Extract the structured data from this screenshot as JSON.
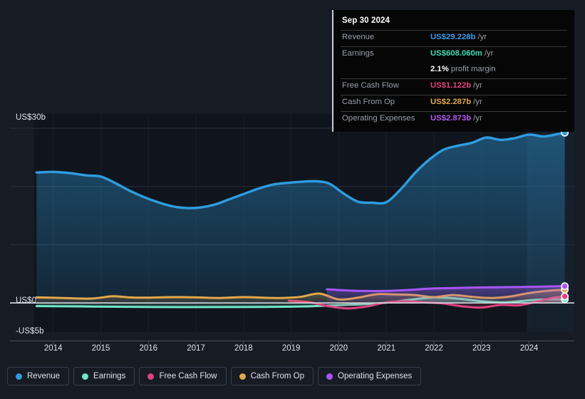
{
  "chart_data": {
    "type": "area",
    "title": "",
    "xlabel": "",
    "ylabel": "",
    "ylim": [
      -5,
      30
    ],
    "xlim": [
      2013.6,
      2024.95
    ],
    "grid": true,
    "legend_position": "bottom",
    "y_ticks": [
      {
        "value": 30,
        "label": "US$30b"
      },
      {
        "value": 0,
        "label": "US$0"
      },
      {
        "value": -5,
        "label": "-US$5b"
      }
    ],
    "x_ticks": [
      "2014",
      "2015",
      "2016",
      "2017",
      "2018",
      "2019",
      "2020",
      "2021",
      "2022",
      "2023",
      "2024"
    ],
    "series": [
      {
        "name": "Revenue",
        "color": "#2e9de0",
        "x": [
          2013.65,
          2014.0,
          2014.35,
          2014.7,
          2015.0,
          2015.3,
          2015.6,
          2015.9,
          2016.2,
          2016.5,
          2016.8,
          2017.1,
          2017.4,
          2017.7,
          2018.0,
          2018.3,
          2018.6,
          2018.9,
          2019.2,
          2019.5,
          2019.8,
          2020.1,
          2020.4,
          2020.7,
          2021.0,
          2021.3,
          2021.6,
          2021.9,
          2022.2,
          2022.5,
          2022.8,
          2023.1,
          2023.4,
          2023.7,
          2024.0,
          2024.3,
          2024.6,
          2024.75
        ],
        "values": [
          22.4,
          22.5,
          22.3,
          21.9,
          21.7,
          20.6,
          19.3,
          18.2,
          17.3,
          16.6,
          16.3,
          16.4,
          16.9,
          17.8,
          18.7,
          19.6,
          20.3,
          20.6,
          20.8,
          20.9,
          20.5,
          18.8,
          17.4,
          17.2,
          17.3,
          19.5,
          22.3,
          24.6,
          26.3,
          27.0,
          27.5,
          28.4,
          28.0,
          28.3,
          28.9,
          28.6,
          29.0,
          29.228
        ]
      },
      {
        "name": "Earnings",
        "color": "#6fe7c8",
        "x": [
          2013.65,
          2014.5,
          2015.3,
          2016.1,
          2016.9,
          2017.7,
          2018.5,
          2019.3,
          2020.1,
          2020.6,
          2021.0,
          2021.5,
          2022.0,
          2022.5,
          2023.0,
          2023.5,
          2024.0,
          2024.4,
          2024.75
        ],
        "values": [
          -0.55,
          -0.6,
          -0.65,
          -0.7,
          -0.72,
          -0.7,
          -0.68,
          -0.6,
          -0.35,
          -0.2,
          0.05,
          0.55,
          0.95,
          0.75,
          0.3,
          0.1,
          0.45,
          0.62,
          0.608
        ]
      },
      {
        "name": "Free Cash Flow",
        "color": "#e0437f",
        "x": [
          2018.95,
          2019.4,
          2019.8,
          2020.2,
          2020.6,
          2021.0,
          2021.4,
          2021.8,
          2022.2,
          2022.6,
          2023.0,
          2023.4,
          2023.8,
          2024.2,
          2024.5,
          2024.75
        ],
        "values": [
          0.4,
          0.1,
          -0.6,
          -0.95,
          -0.6,
          0.1,
          0.3,
          0.1,
          -0.1,
          -0.6,
          -0.8,
          -0.35,
          -0.4,
          0.3,
          0.9,
          1.122
        ]
      },
      {
        "name": "Cash From Op",
        "color": "#e3a84a",
        "x": [
          2013.65,
          2014.2,
          2014.8,
          2015.25,
          2015.6,
          2016.0,
          2016.5,
          2017.0,
          2017.5,
          2018.0,
          2018.4,
          2018.8,
          2019.2,
          2019.6,
          2020.0,
          2020.4,
          2020.8,
          2021.2,
          2021.6,
          2022.0,
          2022.4,
          2022.8,
          2023.2,
          2023.6,
          2024.0,
          2024.4,
          2024.75
        ],
        "values": [
          0.95,
          0.85,
          0.75,
          1.15,
          0.95,
          0.9,
          1.0,
          0.95,
          0.85,
          1.0,
          0.9,
          0.85,
          1.05,
          1.6,
          0.6,
          0.9,
          1.5,
          1.45,
          1.35,
          1.0,
          1.35,
          1.05,
          0.85,
          1.1,
          1.7,
          2.1,
          2.287
        ]
      },
      {
        "name": "Operating Expenses",
        "color": "#a855f7",
        "x": [
          2019.75,
          2020.3,
          2020.9,
          2021.4,
          2021.9,
          2022.4,
          2022.9,
          2023.4,
          2023.9,
          2024.4,
          2024.75
        ],
        "values": [
          2.35,
          2.1,
          2.05,
          2.2,
          2.45,
          2.55,
          2.65,
          2.7,
          2.75,
          2.82,
          2.873
        ]
      }
    ]
  },
  "tooltip": {
    "date": "Sep 30 2024",
    "rows": [
      {
        "key": "Revenue",
        "value": "US$29.228b",
        "suffix": "/yr",
        "color": "#3d9ae8",
        "rule": true
      },
      {
        "key": "Earnings",
        "value": "US$608.060m",
        "suffix": "/yr",
        "color": "#3ddcb0",
        "rule": true
      },
      {
        "key": "",
        "value": "2.1%",
        "suffix": "profit margin",
        "color": "#ffffff",
        "rule": false
      },
      {
        "key": "Free Cash Flow",
        "value": "US$1.122b",
        "suffix": "/yr",
        "color": "#e0437f",
        "rule": true
      },
      {
        "key": "Cash From Op",
        "value": "US$2.287b",
        "suffix": "/yr",
        "color": "#e3a84a",
        "rule": true
      },
      {
        "key": "Operating Expenses",
        "value": "US$2.873b",
        "suffix": "/yr",
        "color": "#b35cf5",
        "rule": true
      }
    ]
  },
  "legend": {
    "items": [
      {
        "label": "Revenue",
        "color": "#2e9de0"
      },
      {
        "label": "Earnings",
        "color": "#6fe7c8"
      },
      {
        "label": "Free Cash Flow",
        "color": "#e0437f"
      },
      {
        "label": "Cash From Op",
        "color": "#e3a84a"
      },
      {
        "label": "Operating Expenses",
        "color": "#a855f7"
      }
    ]
  },
  "colors": {
    "background": "#161b24",
    "plot_background": "#10151d",
    "gridline": "#2b313c",
    "zero_line": "#d6dae0",
    "axis_text": "#dfe3ea",
    "tooltip_background": "#060606",
    "tooltip_border": "#c9ccd2"
  }
}
